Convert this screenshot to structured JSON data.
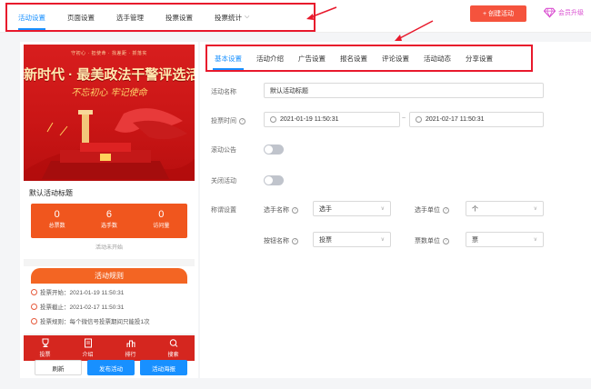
{
  "topnav": {
    "tabs": [
      "活动设置",
      "页面设置",
      "选手管理",
      "投票设置",
      "投票统计"
    ],
    "create_button": "+ 创建活动",
    "vip_label": "会员升级"
  },
  "preview": {
    "banner_slogan": "守初心 · 担使命 · 找差距 · 抓落实",
    "banner_title": "新时代 · 最美政法干警评选活动",
    "banner_subtitle": "不忘初心 牢记使命",
    "activity_title": "默认活动标题",
    "stats": [
      {
        "value": "0",
        "label": "总票数"
      },
      {
        "value": "6",
        "label": "选手数"
      },
      {
        "value": "0",
        "label": "访问量"
      }
    ],
    "status": "活动未开始",
    "rules_title": "活动规则",
    "rules": [
      "投票开始：2021-01-19 11:50:31",
      "投票截止：2021-02-17 11:50:31",
      "投票规则：每个微信号投票期间只能投1次"
    ],
    "bottom_nav": [
      "投票",
      "介绍",
      "排行",
      "搜索"
    ],
    "buttons": {
      "refresh": "刷新",
      "publish": "发布活动",
      "poster": "活动海报"
    }
  },
  "settings": {
    "tabs": [
      "基本设置",
      "活动介绍",
      "广告设置",
      "报名设置",
      "评论设置",
      "活动动态",
      "分享设置"
    ],
    "name_label": "活动名称",
    "name_value": "默认活动标题",
    "time_label": "投票时间",
    "time_start": "2021-01-19 11:50:31",
    "time_dash": "~",
    "time_end": "2021-02-17 11:50:31",
    "notice_label": "滚动公告",
    "close_label": "关闭活动",
    "naming_label": "称谓设置",
    "fields": {
      "player_name_label": "选手名称",
      "player_name_value": "选手",
      "player_unit_label": "选手单位",
      "player_unit_value": "个",
      "button_name_label": "按钮名称",
      "button_name_value": "投票",
      "vote_unit_label": "票数单位",
      "vote_unit_value": "票"
    }
  },
  "colors": {
    "accent": "#1890ff",
    "create": "#f5533d",
    "highlight_box": "#e8192c",
    "banner_red": "#d81e1e",
    "stats_orange": "#f0561e"
  }
}
